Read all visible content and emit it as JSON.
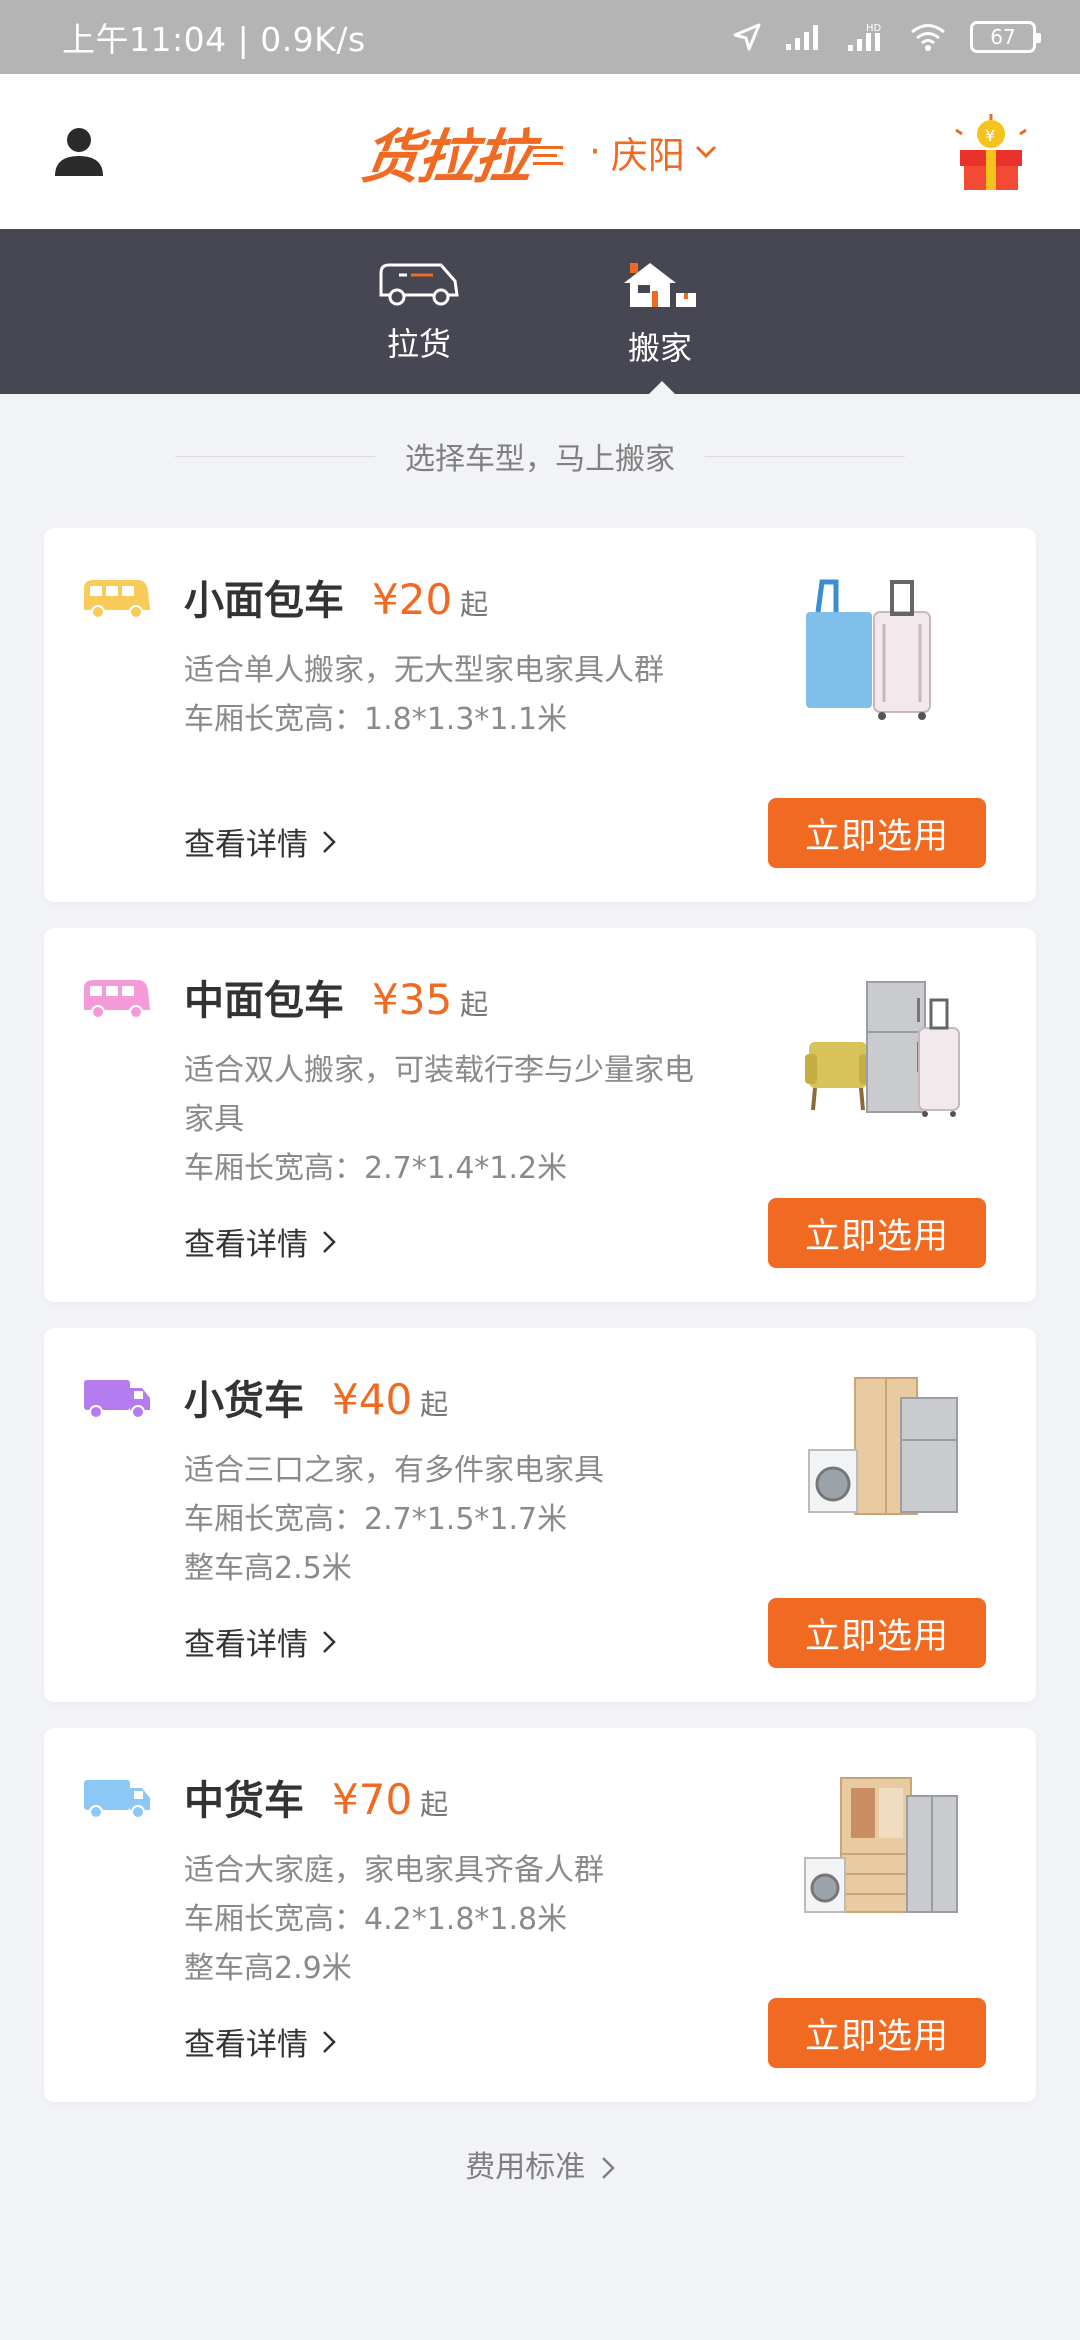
{
  "status_bar": {
    "time": "上午11:04 | 0.9K/s",
    "battery": "67",
    "hd_label": "HD"
  },
  "header": {
    "logo": "货拉拉",
    "city_dot": "·",
    "city": "庆阳",
    "accent_color": "#f06a22"
  },
  "tabs": [
    {
      "label": "拉货",
      "icon": "van-icon",
      "active": false
    },
    {
      "label": "搬家",
      "icon": "house-icon",
      "active": true
    }
  ],
  "section_title": "选择车型，马上搬家",
  "cards": [
    {
      "name": "小面包车",
      "price": "¥20",
      "suffix": "起",
      "desc": [
        "适合单人搬家，无大型家电家具人群",
        "车厢长宽高：1.8*1.3*1.1米"
      ],
      "detail": "查看详情",
      "button": "立即选用",
      "icon_color": "#f9cc5a",
      "illustration": "luggage-illustration"
    },
    {
      "name": "中面包车",
      "price": "¥35",
      "suffix": "起",
      "desc": [
        "适合双人搬家，可装载行李与少量家电家具",
        "车厢长宽高：2.7*1.4*1.2米"
      ],
      "detail": "查看详情",
      "button": "立即选用",
      "icon_color": "#f59ad9",
      "illustration": "chair-fridge-illustration"
    },
    {
      "name": "小货车",
      "price": "¥40",
      "suffix": "起",
      "desc": [
        "适合三口之家，有多件家电家具",
        "车厢长宽高：2.7*1.5*1.7米",
        "整车高2.5米"
      ],
      "detail": "查看详情",
      "button": "立即选用",
      "icon_color": "#b57cf0",
      "illustration": "wardrobe-washer-illustration"
    },
    {
      "name": "中货车",
      "price": "¥70",
      "suffix": "起",
      "desc": [
        "适合大家庭，家电家具齐备人群",
        "车厢长宽高：4.2*1.8*1.8米",
        "整车高2.9米"
      ],
      "detail": "查看详情",
      "button": "立即选用",
      "icon_color": "#8cc8f5",
      "illustration": "cabinet-fridge-illustration"
    }
  ],
  "fee_link": "费用标准"
}
